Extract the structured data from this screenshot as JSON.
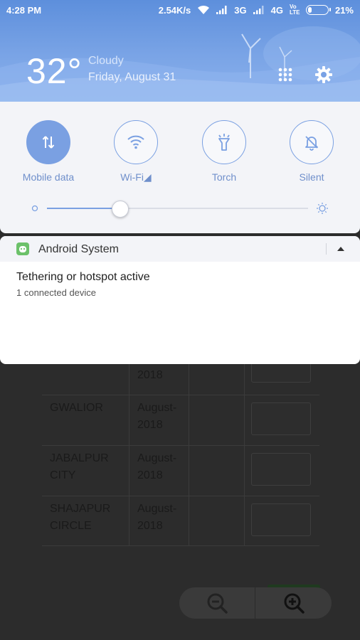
{
  "status_bar": {
    "time": "4:28 PM",
    "net_speed": "2.54K/s",
    "network_1": "3G",
    "network_2": "4G",
    "volte": "Vo LTE",
    "battery": "21%",
    "battery_level": 0.21
  },
  "weather": {
    "temperature": "32°",
    "condition": "Cloudy",
    "date": "Friday, August 31"
  },
  "quick_settings": {
    "tiles": [
      {
        "label": "Mobile data",
        "active": true,
        "icon": "mobile-data-icon"
      },
      {
        "label": "Wi-Fi◢",
        "active": false,
        "icon": "wifi-icon"
      },
      {
        "label": "Torch",
        "active": false,
        "icon": "torch-icon"
      },
      {
        "label": "Silent",
        "active": false,
        "icon": "silent-icon"
      }
    ],
    "brightness_level": 0.28
  },
  "notification": {
    "app": "Android System",
    "title": "Tethering or hotspot active",
    "text": "1 connected device"
  },
  "background_table": {
    "rows": [
      {
        "office": "",
        "month": "2018"
      },
      {
        "office": "GWALIOR",
        "month": "August-\n2018"
      },
      {
        "office": "JABALPUR\nCITY",
        "month": "August-\n2018"
      },
      {
        "office": "SHAJAPUR\nCIRCLE",
        "month": "August-\n2018"
      }
    ]
  },
  "colors": {
    "accent": "#7aa0e2",
    "header_bg": "#6f9be2",
    "panel_bg": "#f3f4f8",
    "app_icon": "#6cc16a"
  }
}
